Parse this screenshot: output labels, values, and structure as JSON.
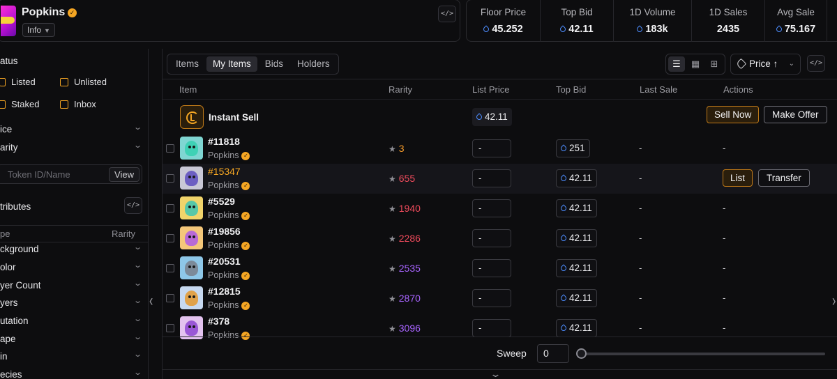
{
  "collection": {
    "name": "Popkins",
    "info_label": "Info",
    "code_glyph": "</>"
  },
  "stats": [
    {
      "label": "Floor Price",
      "value": "45.252",
      "currency": true
    },
    {
      "label": "Top Bid",
      "value": "42.11",
      "currency": true
    },
    {
      "label": "1D Volume",
      "value": "183k",
      "currency": true
    },
    {
      "label": "1D Sales",
      "value": "2435",
      "currency": false
    },
    {
      "label": "Avg Sale",
      "value": "75.167",
      "currency": true
    }
  ],
  "sidebar": {
    "status_title": "atus",
    "status_items": [
      "Listed",
      "Unlisted",
      "Staked",
      "Inbox"
    ],
    "price_label": "ice",
    "rarity_label": "arity",
    "search_placeholder": "Token ID/Name",
    "view_label": "View",
    "attributes_title": "tributes",
    "attr_col_type": "pe",
    "attr_col_rarity": "Rarity",
    "attributes": [
      "ckground",
      "olor",
      "yer Count",
      "yers",
      "utation",
      "ape",
      "in",
      "ecies"
    ]
  },
  "tabs": [
    "Items",
    "My Items",
    "Bids",
    "Holders"
  ],
  "active_tab": "My Items",
  "sort": {
    "label": "Price",
    "direction_glyph": "↑"
  },
  "table": {
    "headers": [
      "Item",
      "Rarity",
      "List Price",
      "Top Bid",
      "Last Sale",
      "Actions"
    ],
    "instant_sell": {
      "label": "Instant Sell",
      "price": "42.11",
      "sell_now": "Sell Now",
      "make_offer": "Make Offer"
    },
    "rows": [
      {
        "id": "#11818",
        "collection": "Popkins",
        "rarity": "3",
        "rarity_tone": "orange",
        "list_price": "-",
        "top_bid": "251",
        "last_sale": "-",
        "action": "-",
        "thumb_bg": "#7fd6d2",
        "blob": "#3fd1b5",
        "highlight": false
      },
      {
        "id": "#15347",
        "collection": "Popkins",
        "rarity": "655",
        "rarity_tone": "red",
        "list_price": "-",
        "top_bid": "42.11",
        "last_sale": "-",
        "action": "",
        "thumb_bg": "#c9c8d6",
        "blob": "#6d5fc2",
        "highlight": true
      },
      {
        "id": "#5529",
        "collection": "Popkins",
        "rarity": "1940",
        "rarity_tone": "red",
        "list_price": "-",
        "top_bid": "42.11",
        "last_sale": "-",
        "action": "-",
        "thumb_bg": "#f1d46b",
        "blob": "#57c7a8",
        "highlight": false
      },
      {
        "id": "#19856",
        "collection": "Popkins",
        "rarity": "2286",
        "rarity_tone": "red",
        "list_price": "-",
        "top_bid": "42.11",
        "last_sale": "-",
        "action": "-",
        "thumb_bg": "#f4c77a",
        "blob": "#b86ad6",
        "highlight": false
      },
      {
        "id": "#20531",
        "collection": "Popkins",
        "rarity": "2535",
        "rarity_tone": "purple",
        "list_price": "-",
        "top_bid": "42.11",
        "last_sale": "-",
        "action": "-",
        "thumb_bg": "#8ec7e8",
        "blob": "#7c8a99",
        "highlight": false
      },
      {
        "id": "#12815",
        "collection": "Popkins",
        "rarity": "2870",
        "rarity_tone": "purple",
        "list_price": "-",
        "top_bid": "42.11",
        "last_sale": "-",
        "action": "-",
        "thumb_bg": "#c7d9f0",
        "blob": "#e0a24a",
        "highlight": false
      },
      {
        "id": "#378",
        "collection": "Popkins",
        "rarity": "3096",
        "rarity_tone": "purple",
        "list_price": "-",
        "top_bid": "42.11",
        "last_sale": "-",
        "action": "-",
        "thumb_bg": "#e3c3ef",
        "blob": "#9a58d6",
        "highlight": false
      }
    ],
    "row_actions": {
      "list": "List",
      "transfer": "Transfer"
    }
  },
  "sweep": {
    "label": "Sweep",
    "value": "0"
  },
  "colors": {
    "accent": "#f5a623",
    "currency": "#4d8dff",
    "background": "#0d0d0f"
  }
}
